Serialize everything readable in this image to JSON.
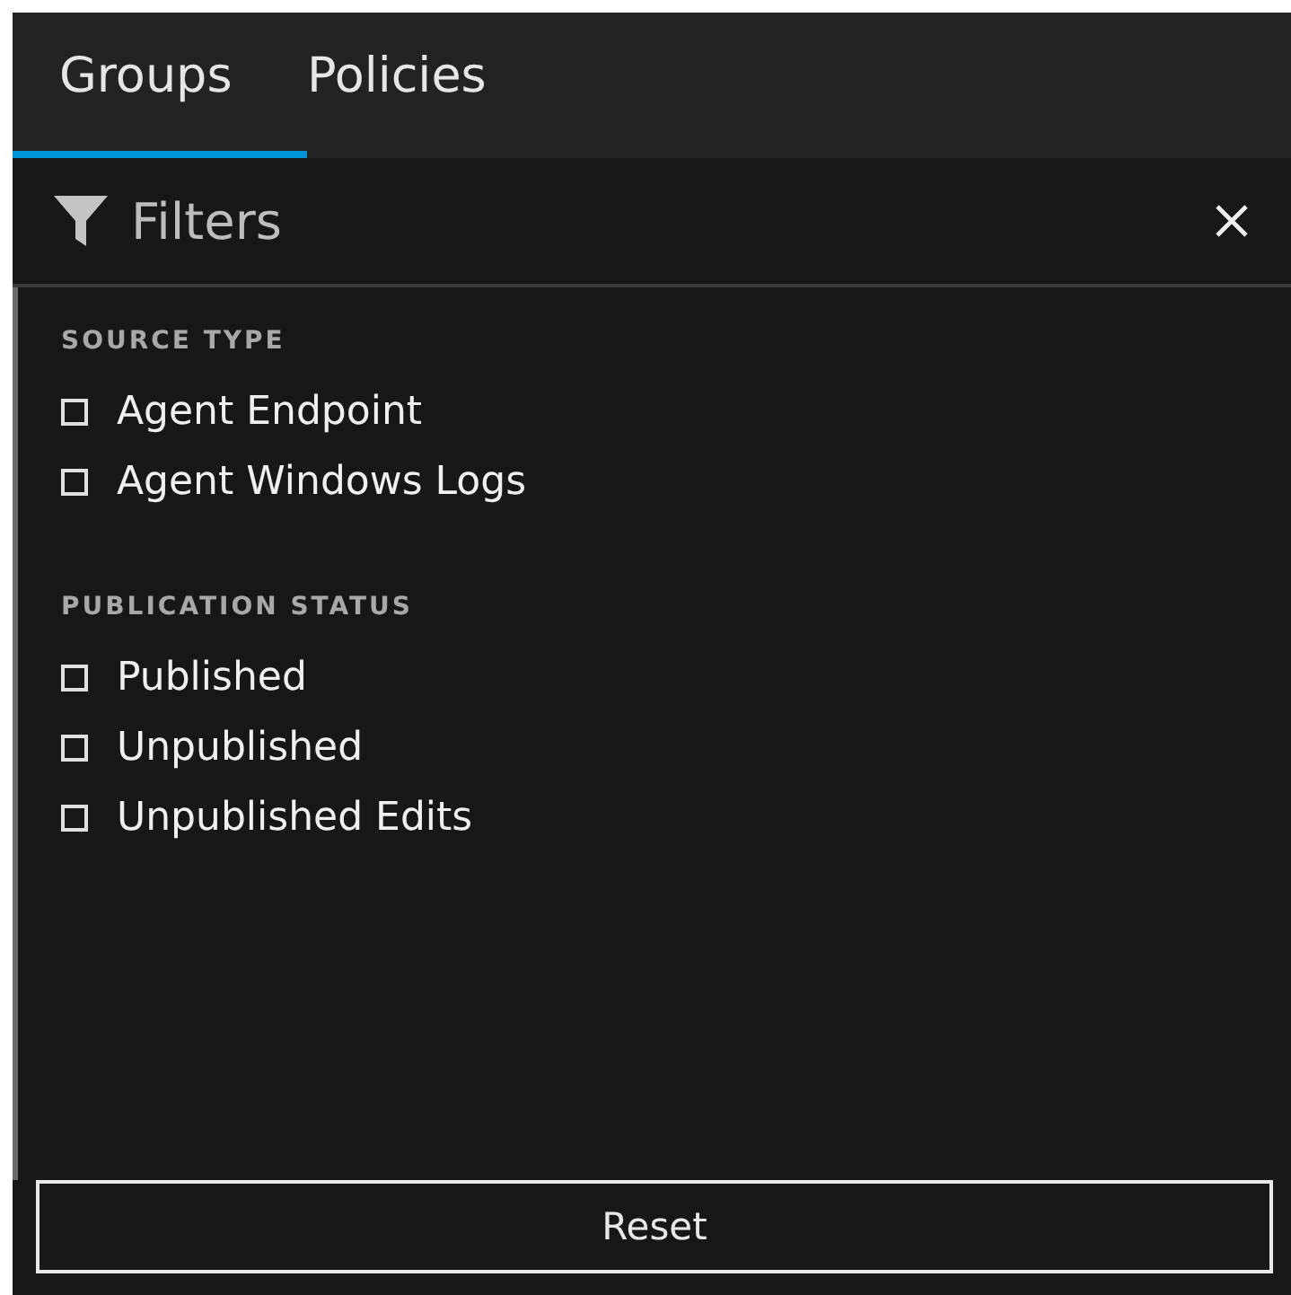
{
  "tabs": [
    {
      "label": "Groups",
      "selected": true
    },
    {
      "label": "Policies",
      "selected": false
    }
  ],
  "filters": {
    "title": "Filters",
    "sections": [
      {
        "heading": "SOURCE TYPE",
        "options": [
          {
            "label": "Agent Endpoint",
            "checked": false
          },
          {
            "label": "Agent Windows Logs",
            "checked": false
          }
        ]
      },
      {
        "heading": "PUBLICATION STATUS",
        "options": [
          {
            "label": "Published",
            "checked": false
          },
          {
            "label": "Unpublished",
            "checked": false
          },
          {
            "label": "Unpublished Edits",
            "checked": false
          }
        ]
      }
    ],
    "reset_button": "Reset"
  }
}
